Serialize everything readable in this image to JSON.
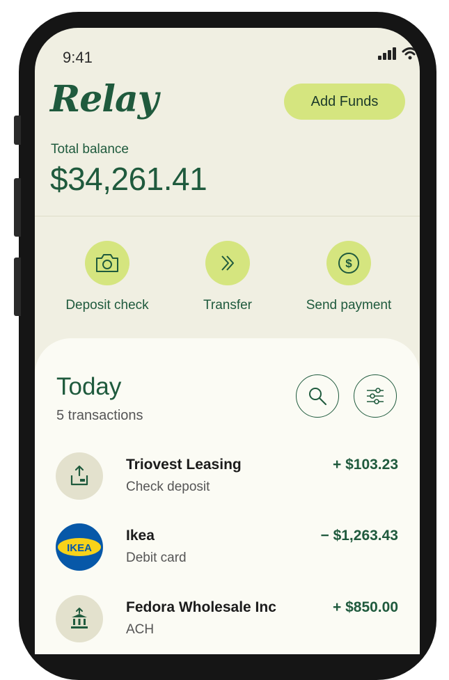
{
  "status": {
    "time": "9:41"
  },
  "header": {
    "logo": "Relay",
    "add_funds_label": "Add Funds"
  },
  "balance": {
    "label": "Total balance",
    "amount": "$34,261.41"
  },
  "actions": [
    {
      "label": "Deposit check",
      "icon": "camera-icon"
    },
    {
      "label": "Transfer",
      "icon": "double-chevron-right-icon"
    },
    {
      "label": "Send payment",
      "icon": "dollar-icon"
    }
  ],
  "today": {
    "title": "Today",
    "count": "5 transactions"
  },
  "transactions": [
    {
      "name": "Triovest Leasing",
      "type": "Check deposit",
      "amount": "+ $103.23",
      "icon": "check-deposit-icon"
    },
    {
      "name": "Ikea",
      "type": "Debit card",
      "amount": "− $1,263.43",
      "icon": "ikea-logo",
      "logo_text": "IKEA"
    },
    {
      "name": "Fedora Wholesale Inc",
      "type": "ACH",
      "amount": "+ $850.00",
      "icon": "bank-icon"
    }
  ],
  "colors": {
    "brand_green": "#1f5a3d",
    "accent_lime": "#d5e57f",
    "background": "#f0efe2",
    "panel": "#fbfbf4"
  }
}
